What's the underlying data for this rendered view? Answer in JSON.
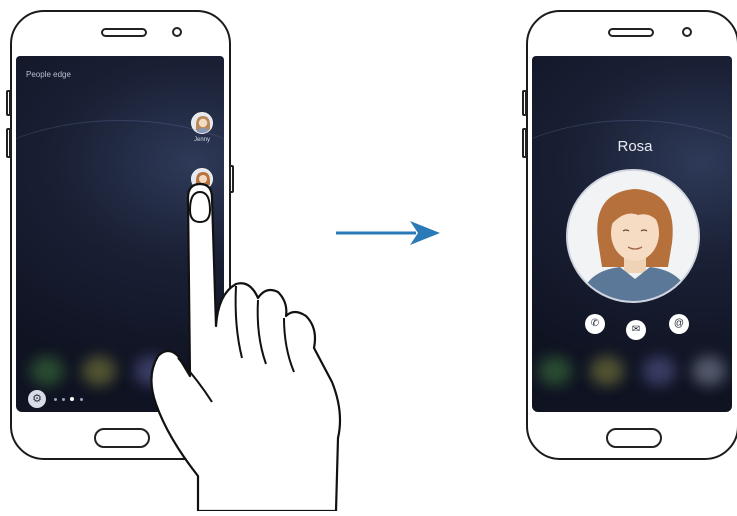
{
  "left_screen": {
    "edge_title": "People edge",
    "contacts": [
      {
        "label": "Jenny",
        "icon": "person-avatar-icon"
      },
      {
        "label": "",
        "icon": "person-avatar-icon"
      }
    ],
    "settings_icon": "⚙",
    "page_indicator": {
      "count": 4,
      "active_index": 2
    }
  },
  "right_screen": {
    "contact_name": "Rosa",
    "actions": [
      {
        "name": "call-button",
        "glyph": "✆"
      },
      {
        "name": "message-button",
        "glyph": "✉"
      },
      {
        "name": "email-button",
        "glyph": "@"
      }
    ]
  },
  "arrow": {
    "direction": "right",
    "color": "#2a7ab8"
  },
  "colors": {
    "screen_bg": "#1a2035",
    "frame": "#1b1b1b",
    "arrow": "#2a7ab8"
  }
}
